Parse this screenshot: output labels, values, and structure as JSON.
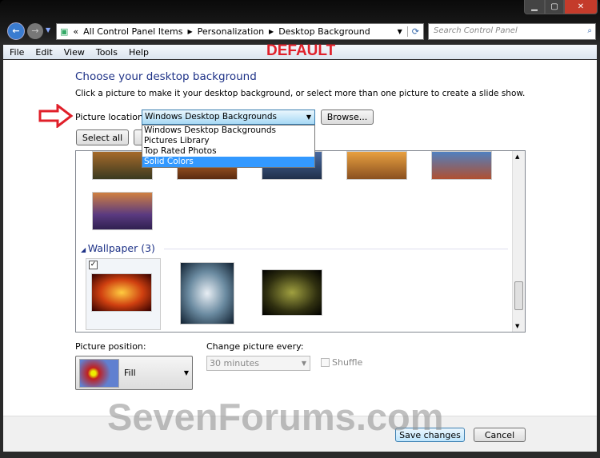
{
  "window": {
    "controls": [
      "minimize",
      "maximize",
      "close"
    ]
  },
  "address": {
    "crumbs": [
      "All Control Panel Items",
      "Personalization",
      "Desktop Background"
    ],
    "search_placeholder": "Search Control Panel"
  },
  "menu": [
    "File",
    "Edit",
    "View",
    "Tools",
    "Help"
  ],
  "overlay": {
    "label": "DEFAULT",
    "watermark": "SevenForums.com",
    "accent": "#e0202a"
  },
  "page": {
    "title": "Choose your desktop background",
    "subtitle": "Click a picture to make it your desktop background, or select more than one picture to create a slide show.",
    "location_label": "Picture location:",
    "location_value": "Windows Desktop Backgrounds",
    "browse": "Browse...",
    "select_all": "Select all",
    "options": [
      "Windows Desktop Backgrounds",
      "Pictures Library",
      "Top Rated Photos",
      "Solid Colors"
    ],
    "selected_option": "Solid Colors",
    "group": "Wallpaper (3)",
    "position_label": "Picture position:",
    "position_value": "Fill",
    "change_label": "Change picture every:",
    "change_value": "30 minutes",
    "shuffle": "Shuffle",
    "save": "Save changes",
    "cancel": "Cancel"
  }
}
